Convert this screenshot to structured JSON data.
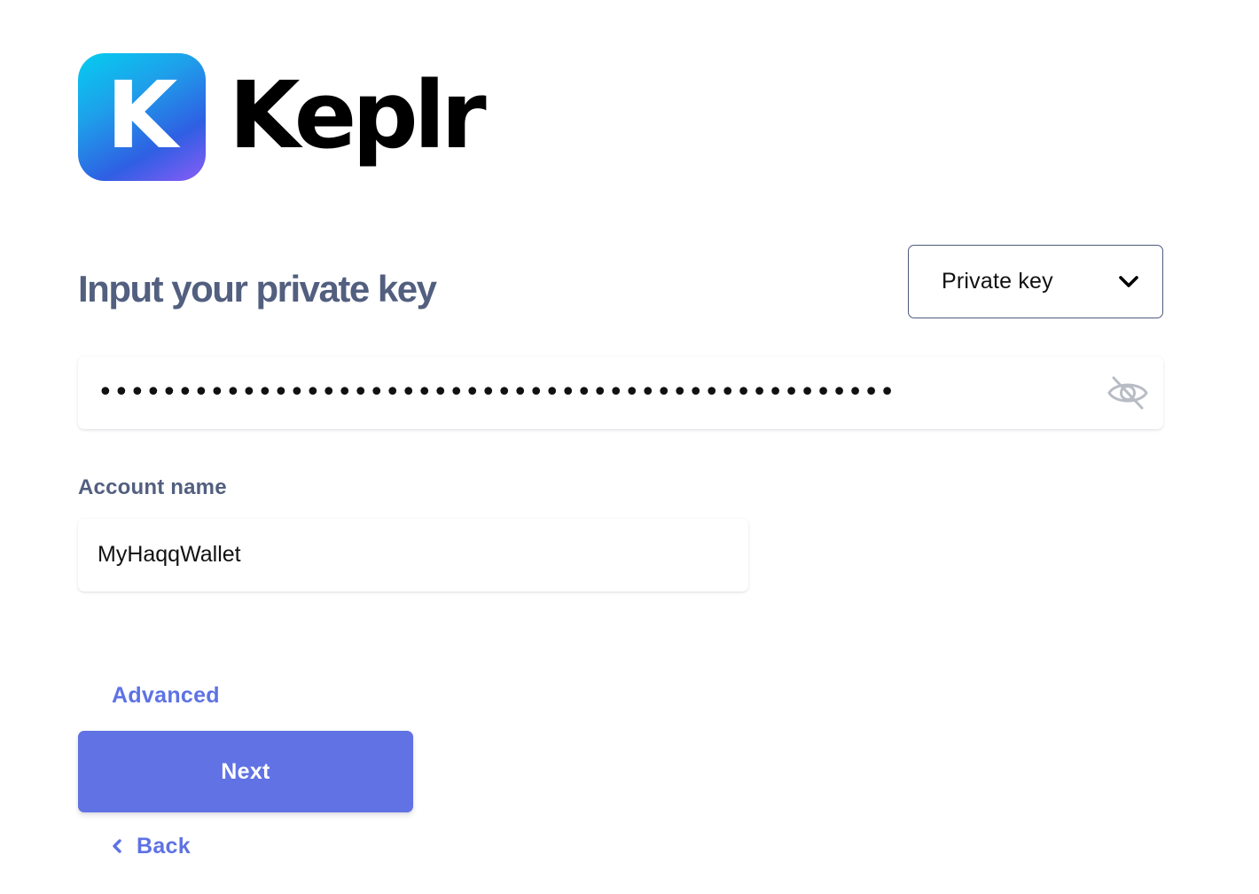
{
  "brand": {
    "logo_letter": "K",
    "name": "Keplr"
  },
  "page": {
    "title": "Input your private key"
  },
  "key_type_select": {
    "value": "Private key",
    "icon": "chevron-down-icon"
  },
  "private_key_field": {
    "masked_value": "••••••••••••••••••••••••••••••••••••••••••••••••••••••••••••••••",
    "icon": "eye-slash-icon"
  },
  "account_name": {
    "label": "Account name",
    "value": "MyHaqqWallet"
  },
  "actions": {
    "advanced_label": "Advanced",
    "next_label": "Next",
    "back_label": "Back"
  },
  "colors": {
    "accent": "#5e72e4",
    "title": "#525f7f",
    "button": "#6072e4"
  }
}
